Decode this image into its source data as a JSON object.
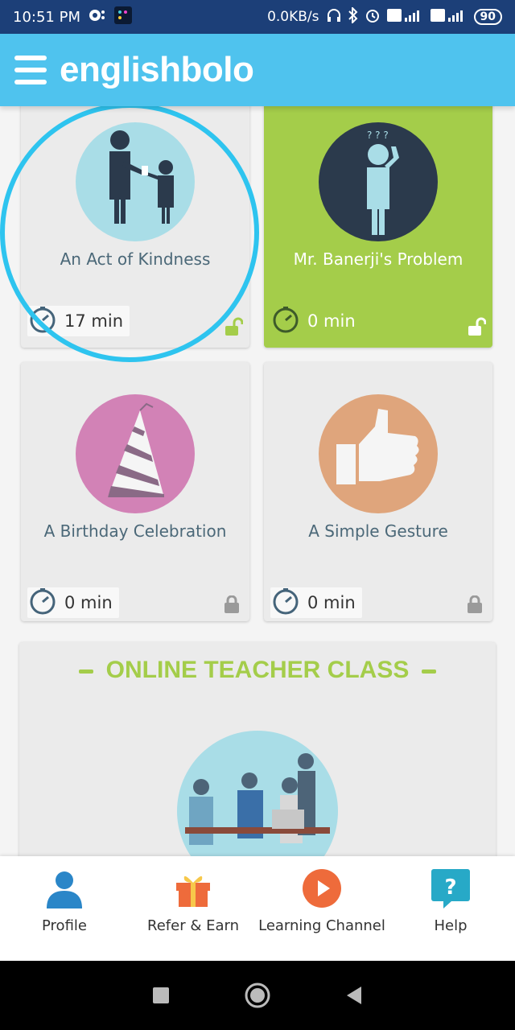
{
  "status_bar": {
    "time": "10:51 PM",
    "speed": "0.0KB/s",
    "battery": "90"
  },
  "app": {
    "logo_text": "englishbolo"
  },
  "lessons": [
    {
      "title": "An Act of Kindness",
      "duration": "17 min",
      "locked": false,
      "circle_color": "#a9dde7",
      "card_color": "#ebebeb"
    },
    {
      "title": "Mr. Banerji's Problem",
      "duration": "0 min",
      "locked": false,
      "circle_color": "#2b3a4c",
      "card_color": "#a4cd4a"
    },
    {
      "title": "A Birthday Celebration",
      "duration": "0 min",
      "locked": true,
      "circle_color": "#d282b6",
      "card_color": "#ebebeb"
    },
    {
      "title": "A Simple Gesture",
      "duration": "0 min",
      "locked": true,
      "circle_color": "#dfa57c",
      "card_color": "#ebebeb"
    }
  ],
  "online_class": {
    "title": "ONLINE TEACHER CLASS"
  },
  "bottom_nav": [
    {
      "label": "Profile",
      "icon": "profile-icon",
      "color": "#2a86c8"
    },
    {
      "label": "Refer & Earn",
      "icon": "gift-icon",
      "color": "#ee6b3b"
    },
    {
      "label": "Learning Channel",
      "icon": "play-icon",
      "color": "#ee6b3b"
    },
    {
      "label": "Help",
      "icon": "help-icon",
      "color": "#27a9c7"
    }
  ],
  "colors": {
    "statusbar": "#1c3f78",
    "appbar": "#4fc3ee",
    "accent_green": "#a4cd4a",
    "highlight": "#2ec4ef"
  }
}
